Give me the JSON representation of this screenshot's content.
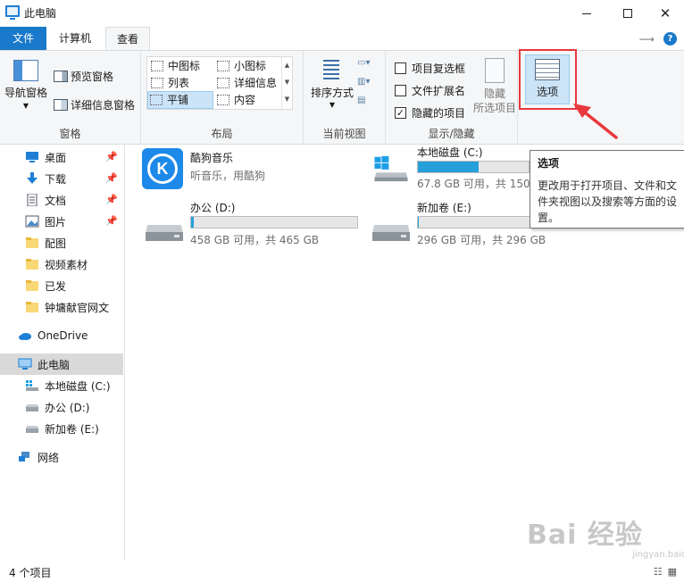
{
  "window": {
    "title": "此电脑",
    "min_glyph": "—",
    "close_glyph": "✕"
  },
  "menu_tabs": {
    "file": "文件",
    "computer": "计算机",
    "view": "查看"
  },
  "ribbon": {
    "pane": {
      "label": "窗格",
      "nav_pane": "导航窗格",
      "preview_pane": "预览窗格",
      "details_pane": "详细信息窗格"
    },
    "layout": {
      "label": "布局",
      "items": [
        "中图标",
        "小图标",
        "列表",
        "详细信息",
        "平铺",
        "内容"
      ],
      "selected": "平铺"
    },
    "current_view": {
      "label": "当前视图",
      "sort_by": "排序方式"
    },
    "show_hide": {
      "label": "显示/隐藏",
      "item_checkboxes": "项目复选框",
      "file_extensions": "文件扩展名",
      "hidden_items": "隐藏的项目",
      "hide_selected_line1": "隐藏",
      "hide_selected_line2": "所选项目",
      "checked": {
        "item_checkboxes": false,
        "file_extensions": false,
        "hidden_items": true
      }
    },
    "options": {
      "label": "选项"
    }
  },
  "tooltip": {
    "title": "选项",
    "body": "更改用于打开项目、文件和文件夹视图以及搜索等方面的设置。"
  },
  "sidebar": {
    "quick_access": [
      {
        "label": "桌面",
        "pinned": true
      },
      {
        "label": "下载",
        "pinned": true
      },
      {
        "label": "文档",
        "pinned": true
      },
      {
        "label": "图片",
        "pinned": true
      },
      {
        "label": "配图",
        "pinned": false
      },
      {
        "label": "视频素材",
        "pinned": false
      },
      {
        "label": "已发",
        "pinned": false
      },
      {
        "label": "钟墉献官网文",
        "pinned": false
      }
    ],
    "onedrive": "OneDrive",
    "this_pc": "此电脑",
    "drives": [
      "本地磁盘 (C:)",
      "办公 (D:)",
      "新加卷 (E:)"
    ],
    "network": "网络"
  },
  "content": {
    "kugou": {
      "name": "酷狗音乐",
      "sub": "听音乐，用酷狗",
      "logo_letter": "K"
    },
    "drive_c": {
      "name": "本地磁盘 (C:)",
      "usage": "67.8 GB 可用，共 150",
      "used_fraction": 0.55
    },
    "drive_d": {
      "name": "办公 (D:)",
      "usage": "458 GB 可用，共 465 GB",
      "used_fraction": 0.015
    },
    "drive_e": {
      "name": "新加卷 (E:)",
      "usage": "296 GB 可用，共 296 GB",
      "used_fraction": 0.005
    }
  },
  "status": {
    "item_count": "4 个项目"
  },
  "watermark": {
    "main": "Bai 经验",
    "sub": "jingyan.baidu.com"
  },
  "colors": {
    "accent": "#1979ca",
    "selection": "#cce4f7",
    "highlight_red": "#e8383d",
    "drive_bar": "#26a0da"
  }
}
